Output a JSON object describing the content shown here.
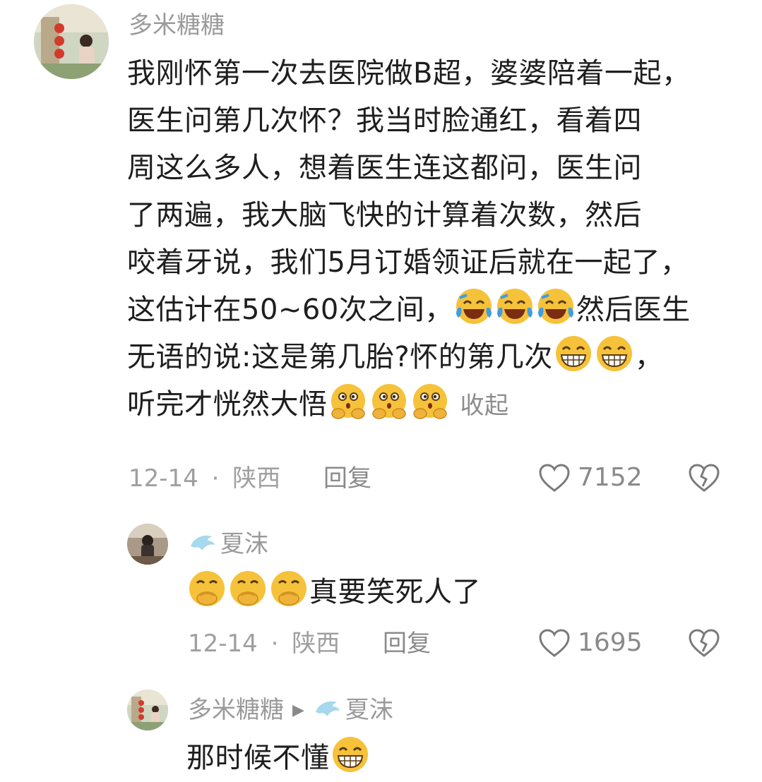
{
  "colors": {
    "text": "#1e1e1e",
    "muted": "#9a9a9a",
    "like_outline": "#7a7a7a"
  },
  "comment1": {
    "username": "多米糖糖",
    "lines": [
      "我刚怀第一次去医院做B超，婆婆陪着一起，",
      "医生问第几次怀？我当时脸通红，看着四",
      "周这么多人，想着医生连这都问，医生问",
      "了两遍，我大脑飞快的计算着次数，然后",
      "咬着牙说，我们5月订婚领证后就在一起了，"
    ],
    "line6_text": "这估计在50~60次之间，",
    "line6_after": "然后医生",
    "line7_text": "无语的说:这是第几胎?怀的第几次",
    "line7_after": "，",
    "line8_text": "听完才恍然大悟",
    "collapse_label": "收起",
    "date": "12-14",
    "separator": "·",
    "location": "陕西",
    "reply_label": "回复",
    "likes": "7152",
    "emojis": [
      "laugh-cry-emoji",
      "grin-emoji",
      "thinking-hug-emoji"
    ]
  },
  "comment2": {
    "username": "夏沫",
    "text": "真要笑死人了",
    "date": "12-14",
    "separator": "·",
    "location": "陕西",
    "reply_label": "回复",
    "likes": "1695",
    "emojis": [
      "cover-mouth-laugh-emoji"
    ]
  },
  "comment3": {
    "username": "多米糖糖",
    "reply_to": "夏沫",
    "text": "那时候不懂",
    "emojis": [
      "grin-emoji"
    ]
  }
}
